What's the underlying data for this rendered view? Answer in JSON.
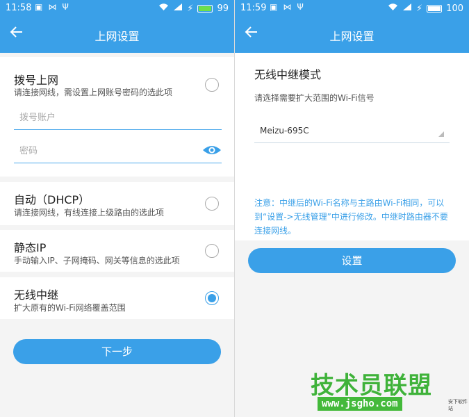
{
  "left": {
    "status": {
      "time": "11:58",
      "battery": "99"
    },
    "header": {
      "title": "上网设置"
    },
    "dialup": {
      "title": "拨号上网",
      "subtitle": "请连接网线，需设置上网账号密码的选此项",
      "account_placeholder": "拨号账户",
      "password_placeholder": "密码"
    },
    "dhcp": {
      "title": "自动（DHCP）",
      "subtitle": "请连接网线，有线连接上级路由的选此项"
    },
    "static_ip": {
      "title": "静态IP",
      "subtitle": "手动输入IP、子网掩码、网关等信息的选此项"
    },
    "repeater": {
      "title": "无线中继",
      "subtitle": "扩大原有的Wi-Fi网络覆盖范围",
      "selected": true
    },
    "next_button": "下一步"
  },
  "right": {
    "status": {
      "time": "11:59",
      "battery": "100"
    },
    "header": {
      "title": "上网设置"
    },
    "mode_title": "无线中继模式",
    "mode_desc": "请选择需要扩大范围的Wi-Fi信号",
    "selected_network": "Meizu-695C",
    "note": "注意：中继后的Wi-Fi名称与主路由Wi-Fi相同，可以到“设置->无线管理”中进行修改。中继时路由器不要连接网线。",
    "set_button": "设置"
  },
  "watermark": {
    "main": "技术员联盟",
    "url": "www.jsgho.com",
    "small": "安下软件站"
  },
  "colors": {
    "accent": "#3aa0e8",
    "background": "#f4f4f4",
    "watermark_green": "#43b93a"
  }
}
